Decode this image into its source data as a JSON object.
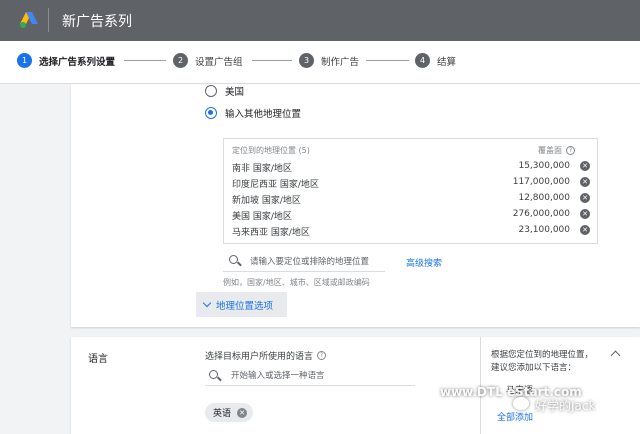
{
  "header": {
    "title": "新广告系列"
  },
  "stepper": {
    "steps": [
      {
        "num": "1",
        "label": "选择广告系列设置"
      },
      {
        "num": "2",
        "label": "设置广告组"
      },
      {
        "num": "3",
        "label": "制作广告"
      },
      {
        "num": "4",
        "label": "结算"
      }
    ]
  },
  "locations": {
    "option_us": "美国",
    "option_other": "输入其他地理位置",
    "table_header": "定位到的地理位置 (5)",
    "reach_header": "覆盖面",
    "rows": [
      {
        "name": "南非 国家/地区",
        "reach": "15,300,000"
      },
      {
        "name": "印度尼西亚 国家/地区",
        "reach": "117,000,000"
      },
      {
        "name": "新加坡 国家/地区",
        "reach": "12,800,000"
      },
      {
        "name": "美国 国家/地区",
        "reach": "276,000,000"
      },
      {
        "name": "马来西亚 国家/地区",
        "reach": "23,100,000"
      }
    ],
    "search_placeholder": "请输入要定位或排除的地理位置",
    "advanced_search": "高级搜索",
    "example": "例如，国家/地区、城市、区域或邮政编码",
    "geo_options": "地理位置选项"
  },
  "language": {
    "title": "语言",
    "description": "选择目标用户所使用的语言",
    "search_placeholder": "开始输入或选择一种语言",
    "selected_chip": "英语",
    "suggest_text": "根据您定位到的地理位置，建议您添加以下语言：",
    "suggested_language": "马来语",
    "add_all": "全部添加"
  },
  "watermark": {
    "url": "www.DTL eStart.com",
    "author": "好学的Jack"
  }
}
